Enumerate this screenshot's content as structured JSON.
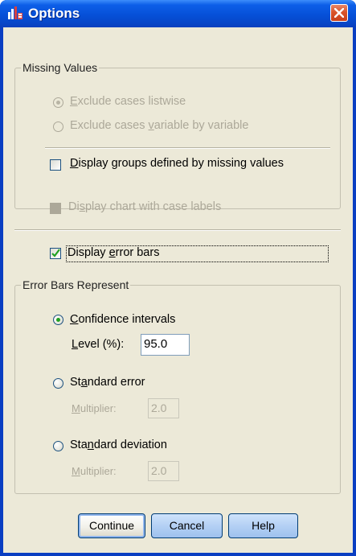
{
  "window": {
    "title": "Options",
    "accent_color": "#0a3ec2",
    "title_icon": "spss-chart-icon",
    "close_icon": "close-icon"
  },
  "missing_values": {
    "legend": "Missing Values",
    "option_listwise": {
      "pre": "",
      "ul": "E",
      "post": "xclude cases listwise",
      "selected": true,
      "enabled": false
    },
    "option_variable": {
      "pre": "Exclude cases ",
      "ul": "v",
      "post": "ariable by variable",
      "selected": false,
      "enabled": false
    },
    "display_groups": {
      "pre": "",
      "ul": "D",
      "post": "isplay groups defined by missing values",
      "checked": false,
      "enabled": true
    }
  },
  "display_chart_case_labels": {
    "pre": "Di",
    "ul": "s",
    "post": "play chart with case labels",
    "checked": false,
    "enabled": false
  },
  "display_error_bars": {
    "pre": "Display ",
    "ul": "e",
    "post": "rror bars",
    "checked": true,
    "enabled": true
  },
  "error_bars": {
    "legend": "Error Bars Represent",
    "confidence": {
      "pre": "",
      "ul": "C",
      "post": "onfidence intervals",
      "selected": true
    },
    "level_label": {
      "pre": "",
      "ul": "L",
      "post": "evel (%):"
    },
    "level_value": "95.0",
    "standard_error": {
      "pre": "St",
      "ul": "a",
      "post": "ndard error",
      "selected": false
    },
    "se_multiplier_label": {
      "pre": "",
      "ul": "M",
      "post": "ultiplier:"
    },
    "se_multiplier_value": "2.0",
    "standard_deviation": {
      "pre": "Sta",
      "ul": "n",
      "post": "dard deviation",
      "selected": false
    },
    "sd_multiplier_label": {
      "pre": "",
      "ul": "M",
      "post": "ultiplier:"
    },
    "sd_multiplier_value": "2.0"
  },
  "buttons": {
    "continue": "Continue",
    "cancel": "Cancel",
    "help": "Help"
  }
}
